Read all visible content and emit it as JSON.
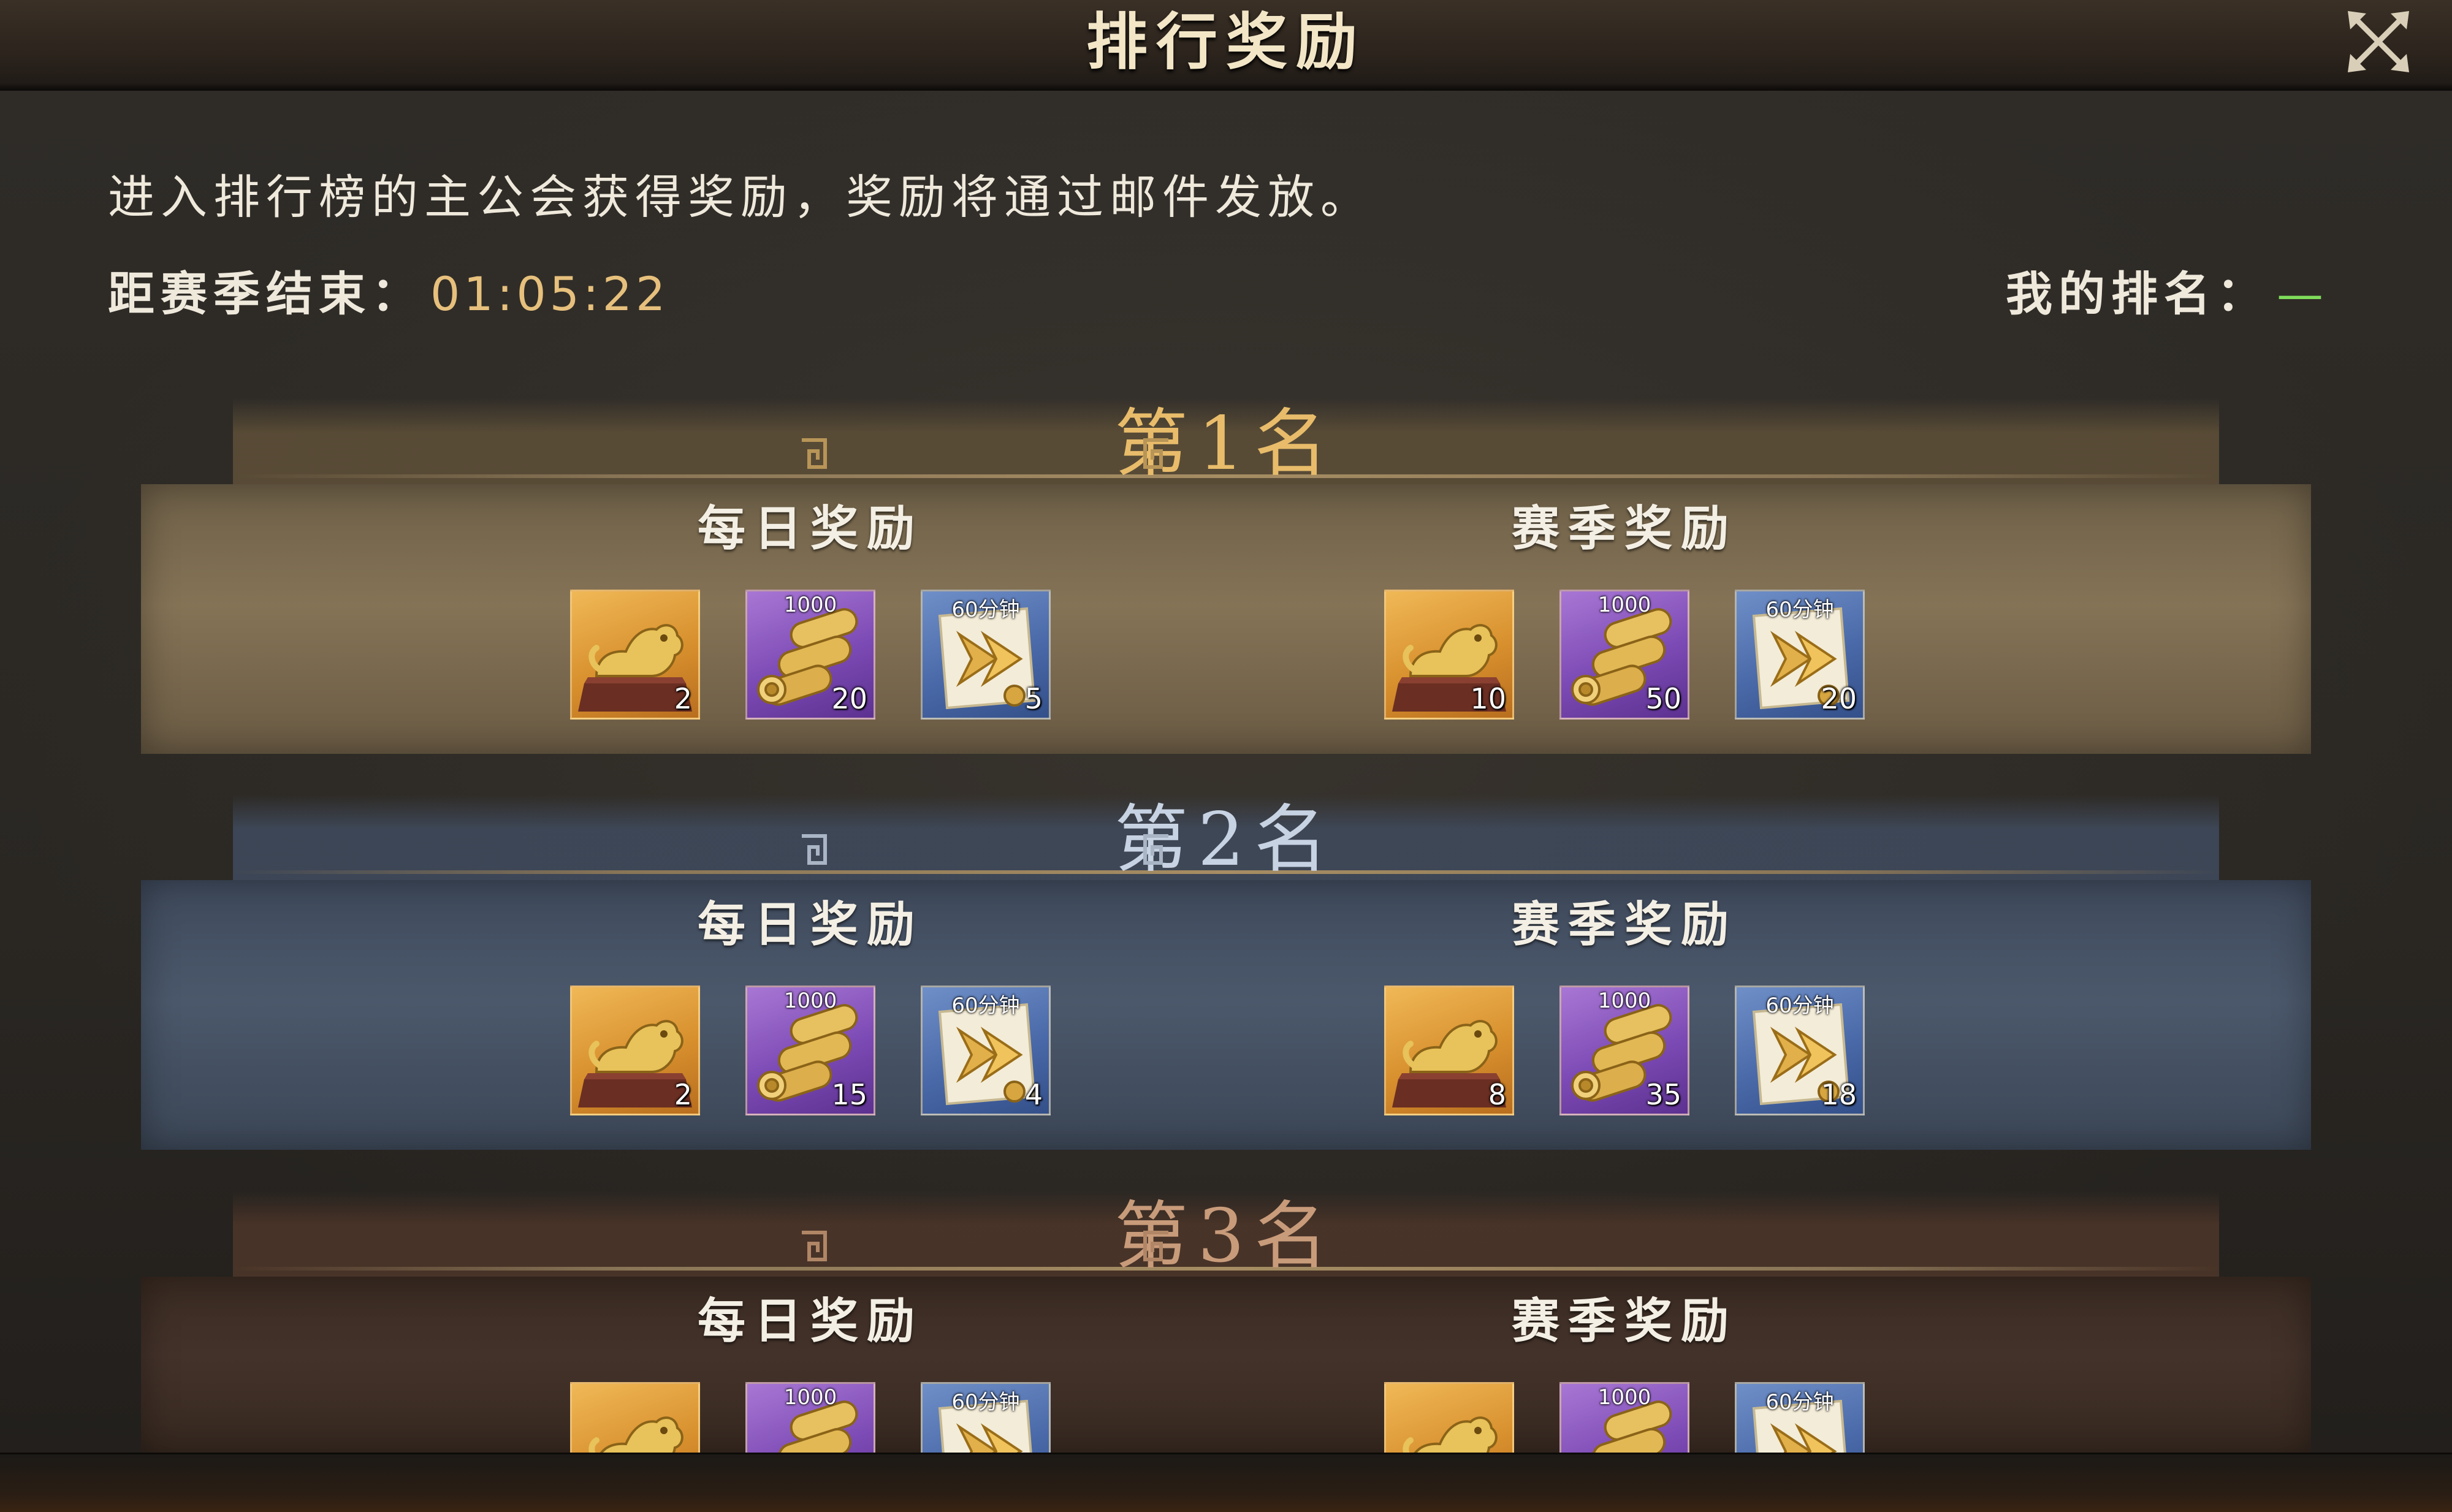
{
  "title": "排行奖励",
  "description": "进入排行榜的主公会获得奖励，奖励将通过邮件发放。",
  "countdown": {
    "label": "距赛季结束：",
    "value": "01:05:22"
  },
  "my_rank": {
    "label": "我的排名：",
    "value": "—"
  },
  "colors": {
    "countdown": "#e6c07c",
    "my_rank_value": "#7fdc5a",
    "rank1_label": "#e8bc6a",
    "rank2_label": "#c7d2e2",
    "rank3_label": "#c89b7a"
  },
  "ranks": [
    {
      "label": "第1名",
      "daily": {
        "title": "每日奖励",
        "items": [
          {
            "icon": "golden-beast-statue-icon",
            "qty": "2"
          },
          {
            "icon": "scroll-bundle-icon",
            "tag": "1000",
            "qty": "20"
          },
          {
            "icon": "speedup-scroll-icon",
            "tag": "60分钟",
            "qty": "5"
          }
        ]
      },
      "season": {
        "title": "赛季奖励",
        "items": [
          {
            "icon": "golden-beast-statue-icon",
            "qty": "10"
          },
          {
            "icon": "scroll-bundle-icon",
            "tag": "1000",
            "qty": "50"
          },
          {
            "icon": "speedup-scroll-icon",
            "tag": "60分钟",
            "qty": "20"
          }
        ]
      }
    },
    {
      "label": "第2名",
      "daily": {
        "title": "每日奖励",
        "items": [
          {
            "icon": "golden-beast-statue-icon",
            "qty": "2"
          },
          {
            "icon": "scroll-bundle-icon",
            "tag": "1000",
            "qty": "15"
          },
          {
            "icon": "speedup-scroll-icon",
            "tag": "60分钟",
            "qty": "4"
          }
        ]
      },
      "season": {
        "title": "赛季奖励",
        "items": [
          {
            "icon": "golden-beast-statue-icon",
            "qty": "8"
          },
          {
            "icon": "scroll-bundle-icon",
            "tag": "1000",
            "qty": "35"
          },
          {
            "icon": "speedup-scroll-icon",
            "tag": "60分钟",
            "qty": "18"
          }
        ]
      }
    },
    {
      "label": "第3名",
      "daily": {
        "title": "每日奖励",
        "items": [
          {
            "icon": "golden-beast-statue-icon"
          },
          {
            "icon": "scroll-bundle-icon",
            "tag": "1000"
          },
          {
            "icon": "speedup-scroll-icon",
            "tag": "60分钟"
          }
        ]
      },
      "season": {
        "title": "赛季奖励",
        "items": [
          {
            "icon": "golden-beast-statue-icon"
          },
          {
            "icon": "scroll-bundle-icon",
            "tag": "1000"
          },
          {
            "icon": "speedup-scroll-icon",
            "tag": "60分钟"
          }
        ]
      }
    }
  ]
}
